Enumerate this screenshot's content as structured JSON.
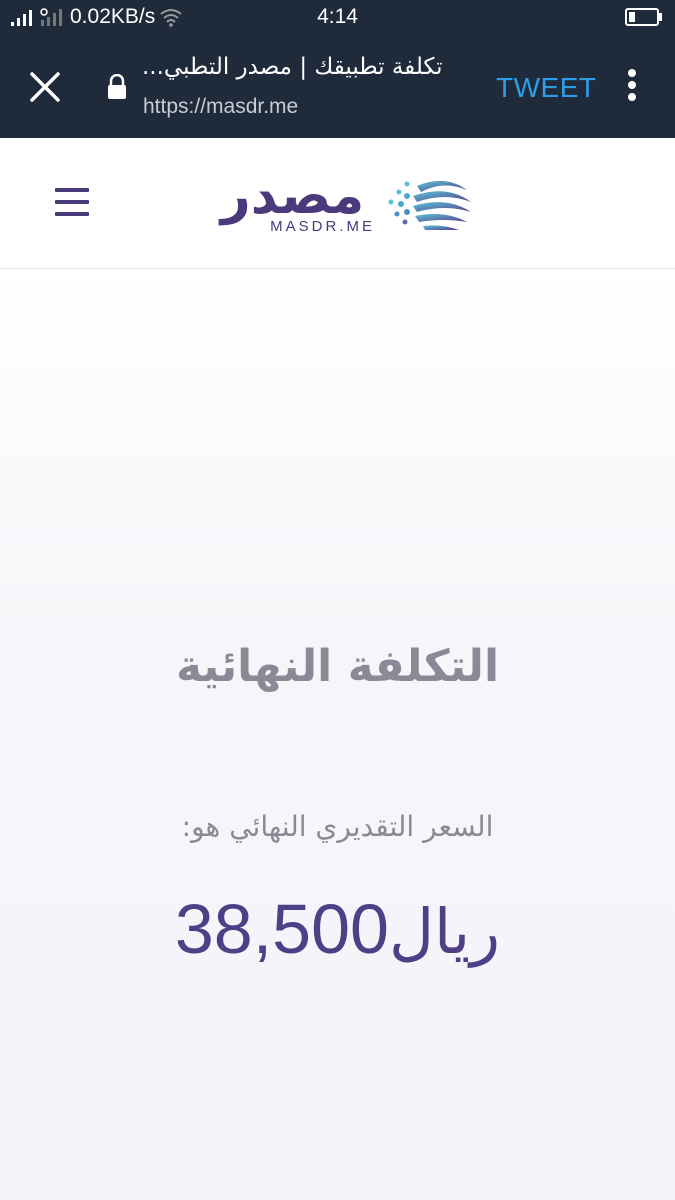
{
  "status_bar": {
    "network_speed": "0.02KB/s",
    "time": "4:14",
    "icons": [
      "signal-icon",
      "signal-icon",
      "wifi-icon",
      "battery-icon"
    ]
  },
  "browser": {
    "page_title": "تكلفة تطبيقك | مصدر التطبي...",
    "url": "https://masdr.me",
    "tweet_label": "TWEET",
    "icons": [
      "close-icon",
      "lock-icon",
      "more-vertical-icon"
    ]
  },
  "site": {
    "logo_arabic": "مصدر",
    "logo_latin": "MASDR.ME",
    "icons": [
      "menu-icon",
      "logo-mark-icon"
    ]
  },
  "main": {
    "title": "التكلفة النهائية",
    "price_label": "السعر التقديري النهائي هو:",
    "price_value": "38,500",
    "price_currency": "ريال"
  },
  "colors": {
    "toolbar_bg": "#1f2a3a",
    "brand_purple": "#4a3a7c",
    "tweet_blue": "#2e9ee8",
    "muted_text": "#8c8896"
  }
}
